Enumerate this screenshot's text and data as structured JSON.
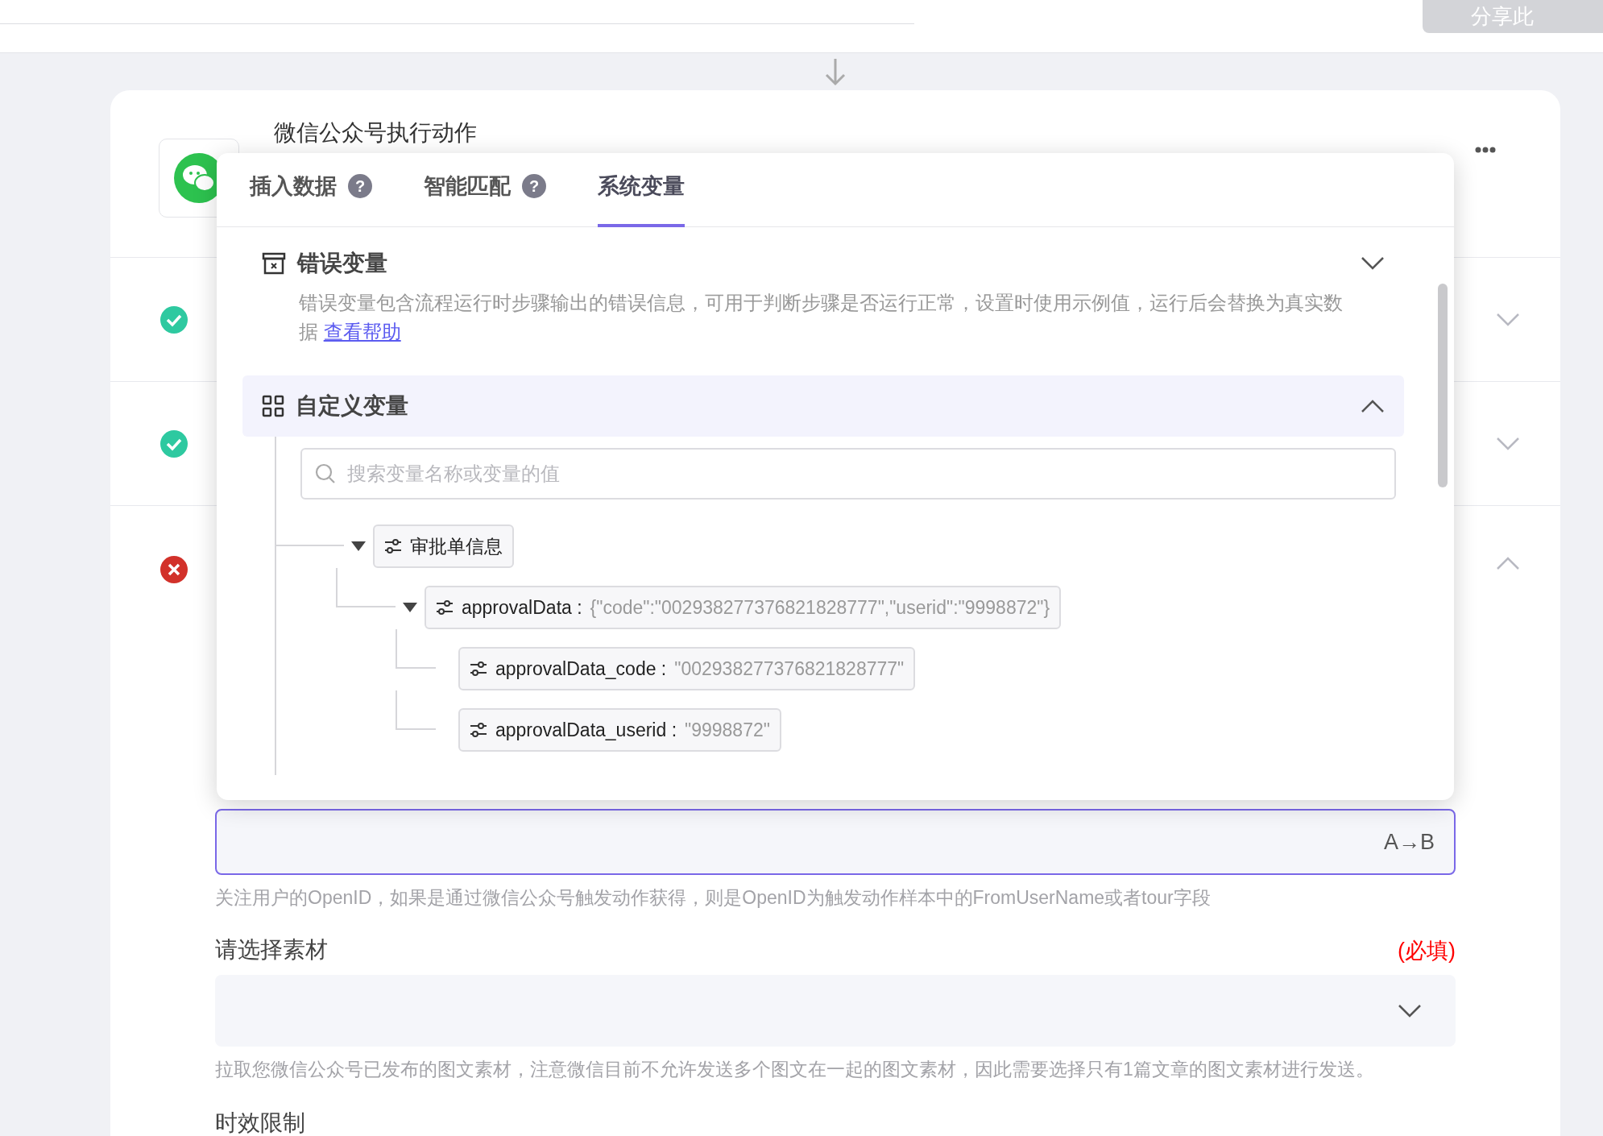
{
  "top_bar": {
    "share_button": "分享此"
  },
  "step_card": {
    "title": "微信公众号执行动作",
    "steps": [
      {
        "failed": false,
        "expanded": false
      },
      {
        "failed": false,
        "expanded": false
      },
      {
        "failed": true,
        "expanded": true
      }
    ]
  },
  "popup": {
    "tabs": [
      {
        "label": "插入数据",
        "help": "?",
        "selected": false
      },
      {
        "label": "智能匹配",
        "help": "?",
        "selected": false
      },
      {
        "label": "系统变量",
        "selected": true
      }
    ],
    "sections": [
      {
        "kind": "error",
        "title": "错误变量",
        "expanded": false,
        "description": "错误变量包含流程运行时步骤输出的错误信息，可用于判断步骤是否运行正常，设置时使用示例值，运行后会替换为真实数据",
        "help_link": "查看帮助"
      },
      {
        "kind": "custom",
        "title": "自定义变量",
        "expanded": true,
        "search_placeholder": "搜索变量名称或变量的值",
        "tree": [
          {
            "label": "审批单信息",
            "expanded": true,
            "children": [
              {
                "label": "approvalData :",
                "value": "{\"code\":\"002938277376821828777\",\"userid\":\"9998872\"}",
                "expanded": true,
                "children": [
                  {
                    "label": "approvalData_code :",
                    "value": "\"002938277376821828777\""
                  },
                  {
                    "label": "approvalData_userid :",
                    "value": "\"9998872\""
                  }
                ]
              }
            ]
          }
        ]
      }
    ]
  },
  "form": {
    "openid_field": {
      "button": "A→B",
      "hint": "关注用户的OpenID，如果是通过微信公众号触发动作获得，则是OpenID为触发动作样本中的FromUserName或者tour字段"
    },
    "material": {
      "label": "请选择素材",
      "required": "(必填)",
      "hint": "拉取您微信公众号已发布的图文素材，注意微信目前不允许发送多个图文在一起的图文素材，因此需要选择只有1篇文章的图文素材进行发送。"
    },
    "next_label": "时效限制"
  }
}
